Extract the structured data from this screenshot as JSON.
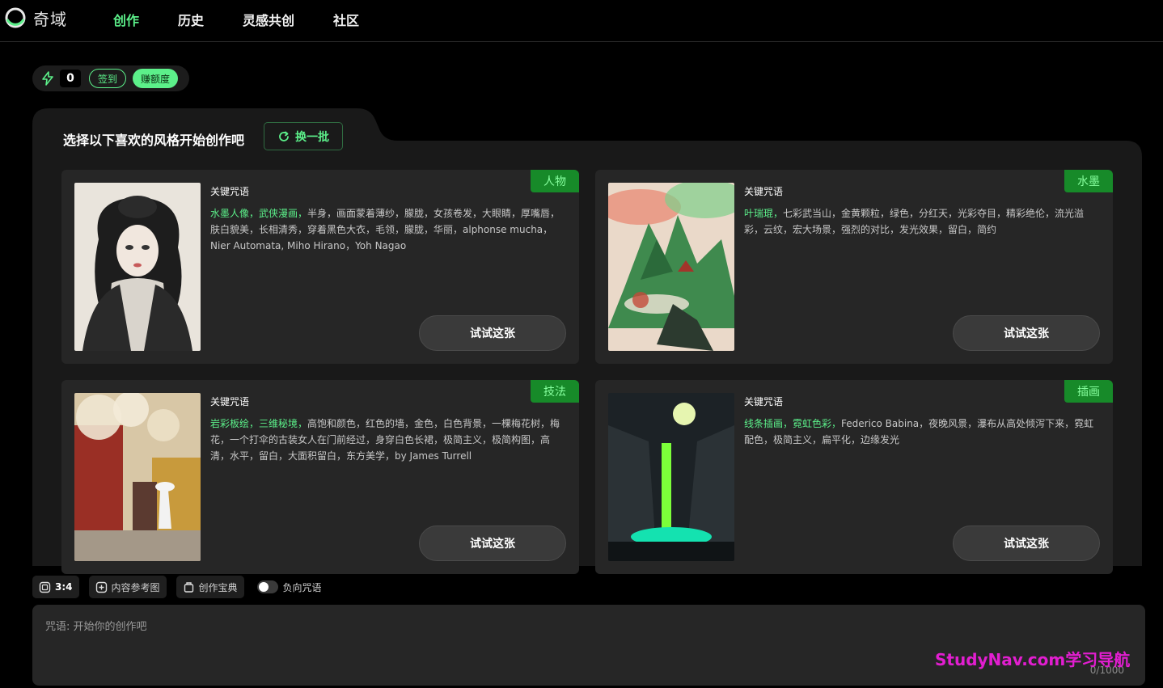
{
  "brand": {
    "name": "奇域",
    "accent": "#5cf08a"
  },
  "nav": {
    "items": [
      "创作",
      "历史",
      "灵感共创",
      "社区"
    ],
    "active": 0
  },
  "credits": {
    "count": "0",
    "checkin": "签到",
    "earn": "赚额度"
  },
  "panel": {
    "title": "选择以下喜欢的风格开始创作吧",
    "refresh": "换一批"
  },
  "cards": [
    {
      "tag": "人物",
      "kw_label": "关键咒语",
      "highlight": "水墨人像，武侠漫画，",
      "text": "半身，画面蒙着薄纱，朦胧，女孩卷发，大眼睛，厚嘴唇，肤白貌美，长相清秀，穿着黑色大衣，毛领，朦胧，华丽，alphonse mucha，Nier Automata, Miho Hirano，Yoh Nagao",
      "button": "试试这张"
    },
    {
      "tag": "水墨",
      "kw_label": "关键咒语",
      "highlight": "叶瑞琨，",
      "text": "七彩武当山，金黄颗粒，绿色，分红天，光彩夺目，精彩绝伦，流光溢彩，云纹，宏大场景，强烈的对比，发光效果，留白，简约",
      "button": "试试这张"
    },
    {
      "tag": "技法",
      "kw_label": "关键咒语",
      "highlight": "岩彩板绘，三维秘境，",
      "text": "高饱和颜色，红色的墙，金色，白色背景，一棵梅花树，梅花，一个打伞的古装女人在门前经过，身穿白色长裙，极简主义，极简构图，高清，水平，留白，大面积留白，东方美学，by James Turrell",
      "button": "试试这张"
    },
    {
      "tag": "插画",
      "kw_label": "关键咒语",
      "highlight": "线条插画，霓虹色彩，",
      "text": "Federico Babina，夜晚风景，瀑布从高处倾泻下来，霓虹配色，极简主义，扁平化，边缘发光",
      "button": "试试这张"
    }
  ],
  "tools": {
    "ratio": "3:4",
    "ref": "内容参考图",
    "book": "创作宝典",
    "negative": "负向咒语"
  },
  "prompt": {
    "placeholder": "咒语: 开始你的创作吧",
    "counter": "0/1000"
  },
  "watermark": "StudyNav.com学习导航"
}
